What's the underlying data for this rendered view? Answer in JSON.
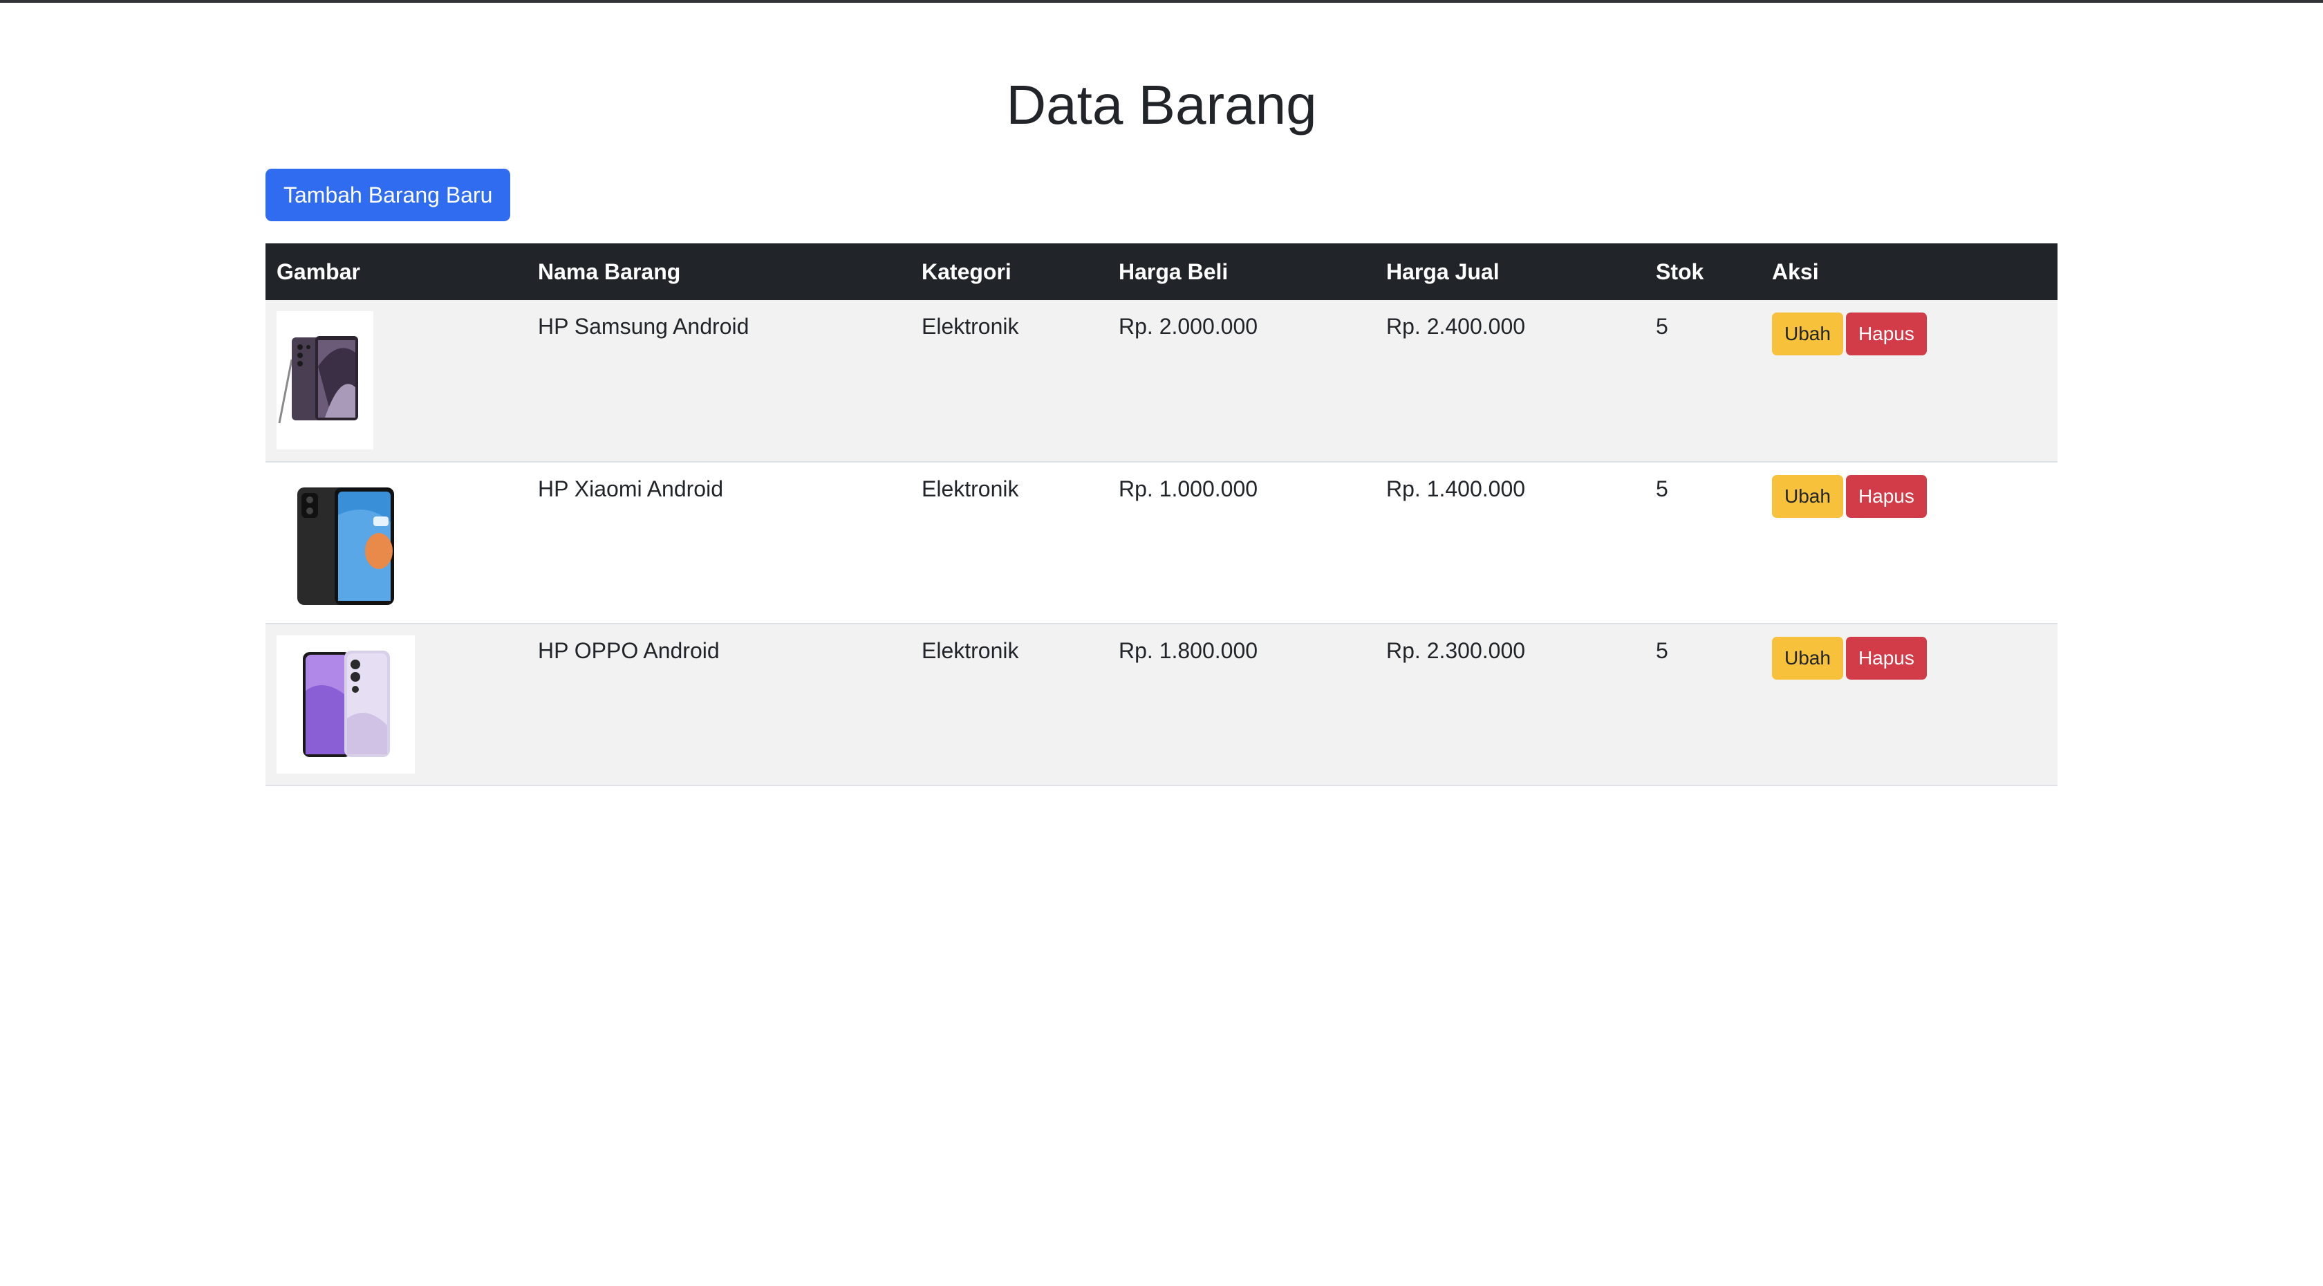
{
  "page": {
    "title": "Data Barang",
    "add_button_label": "Tambah Barang Baru"
  },
  "table": {
    "columns": [
      "Gambar",
      "Nama Barang",
      "Kategori",
      "Harga Beli",
      "Harga Jual",
      "Stok",
      "Aksi"
    ],
    "rows": [
      {
        "image_icon": "samsung-phone-image",
        "nama": "HP Samsung Android",
        "kategori": "Elektronik",
        "harga_beli": "Rp. 2.000.000",
        "harga_jual": "Rp. 2.400.000",
        "stok": "5",
        "edit_label": "Ubah",
        "delete_label": "Hapus"
      },
      {
        "image_icon": "xiaomi-phone-image",
        "nama": "HP Xiaomi Android",
        "kategori": "Elektronik",
        "harga_beli": "Rp. 1.000.000",
        "harga_jual": "Rp. 1.400.000",
        "stok": "5",
        "edit_label": "Ubah",
        "delete_label": "Hapus"
      },
      {
        "image_icon": "oppo-phone-image",
        "nama": "HP OPPO Android",
        "kategori": "Elektronik",
        "harga_beli": "Rp. 1.800.000",
        "harga_jual": "Rp. 2.300.000",
        "stok": "5",
        "edit_label": "Ubah",
        "delete_label": "Hapus"
      }
    ]
  },
  "colors": {
    "header_bg": "#212529",
    "primary": "#2f6cf0",
    "warning": "#f7c13b",
    "danger": "#d23c48",
    "stripe": "#f2f2f2"
  }
}
